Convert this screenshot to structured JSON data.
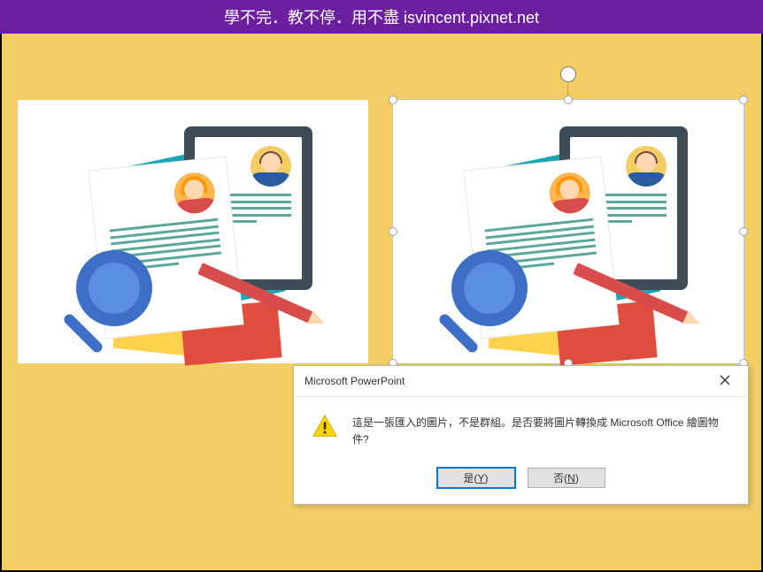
{
  "header": {
    "title": "學不完．教不停．用不盡 isvincent.pixnet.net"
  },
  "dialog": {
    "title": "Microsoft PowerPoint",
    "message": "這是一張匯入的圖片，不是群組。是否要將圖片轉換成 Microsoft Office 繪圖物件?",
    "yes_prefix": "是(",
    "yes_key": "Y",
    "yes_suffix": ")",
    "no_prefix": "否(",
    "no_key": "N",
    "no_suffix": ")"
  },
  "icons": {
    "warning": "warning-icon",
    "close": "close-icon",
    "rotate": "rotate-handle-icon"
  },
  "colors": {
    "header_bg": "#6b1f9e",
    "canvas_bg": "#f4cd65",
    "selection": "#0078d7"
  }
}
